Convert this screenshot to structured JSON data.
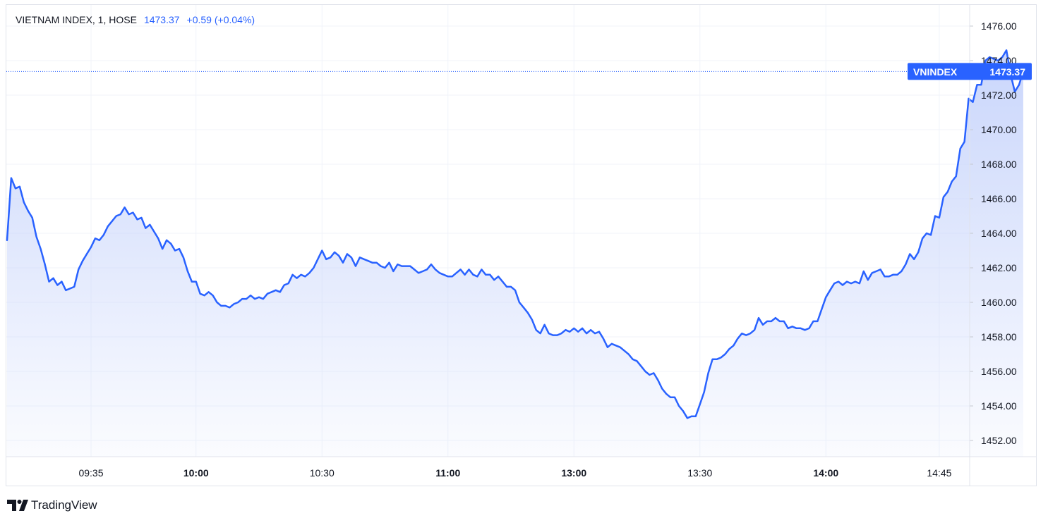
{
  "legend": {
    "symbol": "VIETNAM INDEX, 1, HOSE",
    "price": "1473.37",
    "change": "+0.59 (+0.04%)"
  },
  "last_label": {
    "symbol": "VNINDEX",
    "price": "1473.37"
  },
  "branding": {
    "name": "TradingView",
    "icon": "tradingview-logo-icon"
  },
  "colors": {
    "line": "#2962ff",
    "fill_top": "#c7d4fb",
    "grid": "#f0f3fa",
    "axis_text": "#131722"
  },
  "chart_data": {
    "type": "area",
    "ylim": [
      1451,
      1477
    ],
    "y_ticks": [
      "1452.00",
      "1454.00",
      "1456.00",
      "1458.00",
      "1460.00",
      "1462.00",
      "1464.00",
      "1466.00",
      "1468.00",
      "1470.00",
      "1472.00",
      "1474.00",
      "1476.00"
    ],
    "x_ticks": [
      {
        "label": "09:35",
        "idx": 20,
        "bold": false
      },
      {
        "label": "10:00",
        "idx": 45,
        "bold": true
      },
      {
        "label": "10:30",
        "idx": 75,
        "bold": false
      },
      {
        "label": "11:00",
        "idx": 105,
        "bold": true
      },
      {
        "label": "13:00",
        "idx": 135,
        "bold": true
      },
      {
        "label": "13:30",
        "idx": 165,
        "bold": false
      },
      {
        "label": "14:00",
        "idx": 195,
        "bold": true
      },
      {
        "label": "14:45",
        "idx": 222,
        "bold": false
      }
    ],
    "last_value": 1473.37,
    "values": [
      1463.6,
      1467.2,
      1466.6,
      1466.7,
      1465.8,
      1465.3,
      1464.9,
      1463.8,
      1463.1,
      1462.2,
      1461.2,
      1461.4,
      1461.0,
      1461.2,
      1460.7,
      1460.8,
      1460.9,
      1461.9,
      1462.4,
      1462.8,
      1463.2,
      1463.7,
      1463.6,
      1463.9,
      1464.4,
      1464.7,
      1465.0,
      1465.1,
      1465.5,
      1465.1,
      1465.2,
      1464.8,
      1464.9,
      1464.3,
      1464.5,
      1464.1,
      1463.7,
      1463.1,
      1463.6,
      1463.4,
      1463.0,
      1463.1,
      1462.6,
      1461.8,
      1461.2,
      1461.2,
      1460.5,
      1460.4,
      1460.6,
      1460.4,
      1460.0,
      1459.8,
      1459.8,
      1459.7,
      1459.9,
      1460.0,
      1460.2,
      1460.2,
      1460.4,
      1460.2,
      1460.3,
      1460.2,
      1460.5,
      1460.6,
      1460.7,
      1460.6,
      1461.0,
      1461.1,
      1461.6,
      1461.4,
      1461.6,
      1461.5,
      1461.7,
      1462.0,
      1462.5,
      1463.0,
      1462.5,
      1462.6,
      1462.9,
      1462.7,
      1462.3,
      1462.8,
      1462.6,
      1462.1,
      1462.6,
      1462.5,
      1462.4,
      1462.3,
      1462.3,
      1462.1,
      1462.0,
      1462.3,
      1461.8,
      1462.2,
      1462.1,
      1462.1,
      1462.1,
      1461.9,
      1461.7,
      1461.8,
      1461.9,
      1462.2,
      1461.9,
      1461.7,
      1461.6,
      1461.5,
      1461.5,
      1461.7,
      1461.9,
      1461.6,
      1461.9,
      1461.6,
      1461.5,
      1461.9,
      1461.6,
      1461.6,
      1461.3,
      1461.5,
      1461.2,
      1460.9,
      1460.9,
      1460.7,
      1460.0,
      1459.7,
      1459.4,
      1459.0,
      1458.4,
      1458.2,
      1458.7,
      1458.2,
      1458.1,
      1458.1,
      1458.2,
      1458.4,
      1458.3,
      1458.5,
      1458.3,
      1458.5,
      1458.2,
      1458.4,
      1458.2,
      1458.3,
      1457.9,
      1457.4,
      1457.6,
      1457.5,
      1457.4,
      1457.2,
      1457.0,
      1456.7,
      1456.6,
      1456.3,
      1456.0,
      1455.8,
      1455.9,
      1455.5,
      1455.0,
      1454.7,
      1454.5,
      1454.5,
      1454.0,
      1453.7,
      1453.3,
      1453.4,
      1453.4,
      1454.1,
      1454.8,
      1455.9,
      1456.7,
      1456.7,
      1456.8,
      1457.0,
      1457.3,
      1457.5,
      1457.9,
      1458.2,
      1458.1,
      1458.2,
      1458.4,
      1459.1,
      1458.7,
      1458.9,
      1458.9,
      1459.1,
      1458.9,
      1458.9,
      1458.5,
      1458.6,
      1458.5,
      1458.5,
      1458.4,
      1458.5,
      1458.9,
      1458.9,
      1459.6,
      1460.3,
      1460.7,
      1461.1,
      1461.2,
      1461.0,
      1461.2,
      1461.1,
      1461.2,
      1461.1,
      1461.8,
      1461.3,
      1461.7,
      1461.8,
      1461.9,
      1461.5,
      1461.5,
      1461.6,
      1461.6,
      1461.8,
      1462.2,
      1462.8,
      1462.5,
      1462.9,
      1463.7,
      1464.0,
      1463.9,
      1465.0,
      1464.9,
      1466.1,
      1466.4,
      1467.0,
      1467.3,
      1468.9,
      1469.3,
      1471.8,
      1471.6,
      1472.6,
      1472.6,
      1474.0,
      1474.2,
      1474.1,
      1474.0,
      1474.2,
      1474.6,
      1473.2,
      1472.2,
      1472.6,
      1473.37
    ]
  }
}
